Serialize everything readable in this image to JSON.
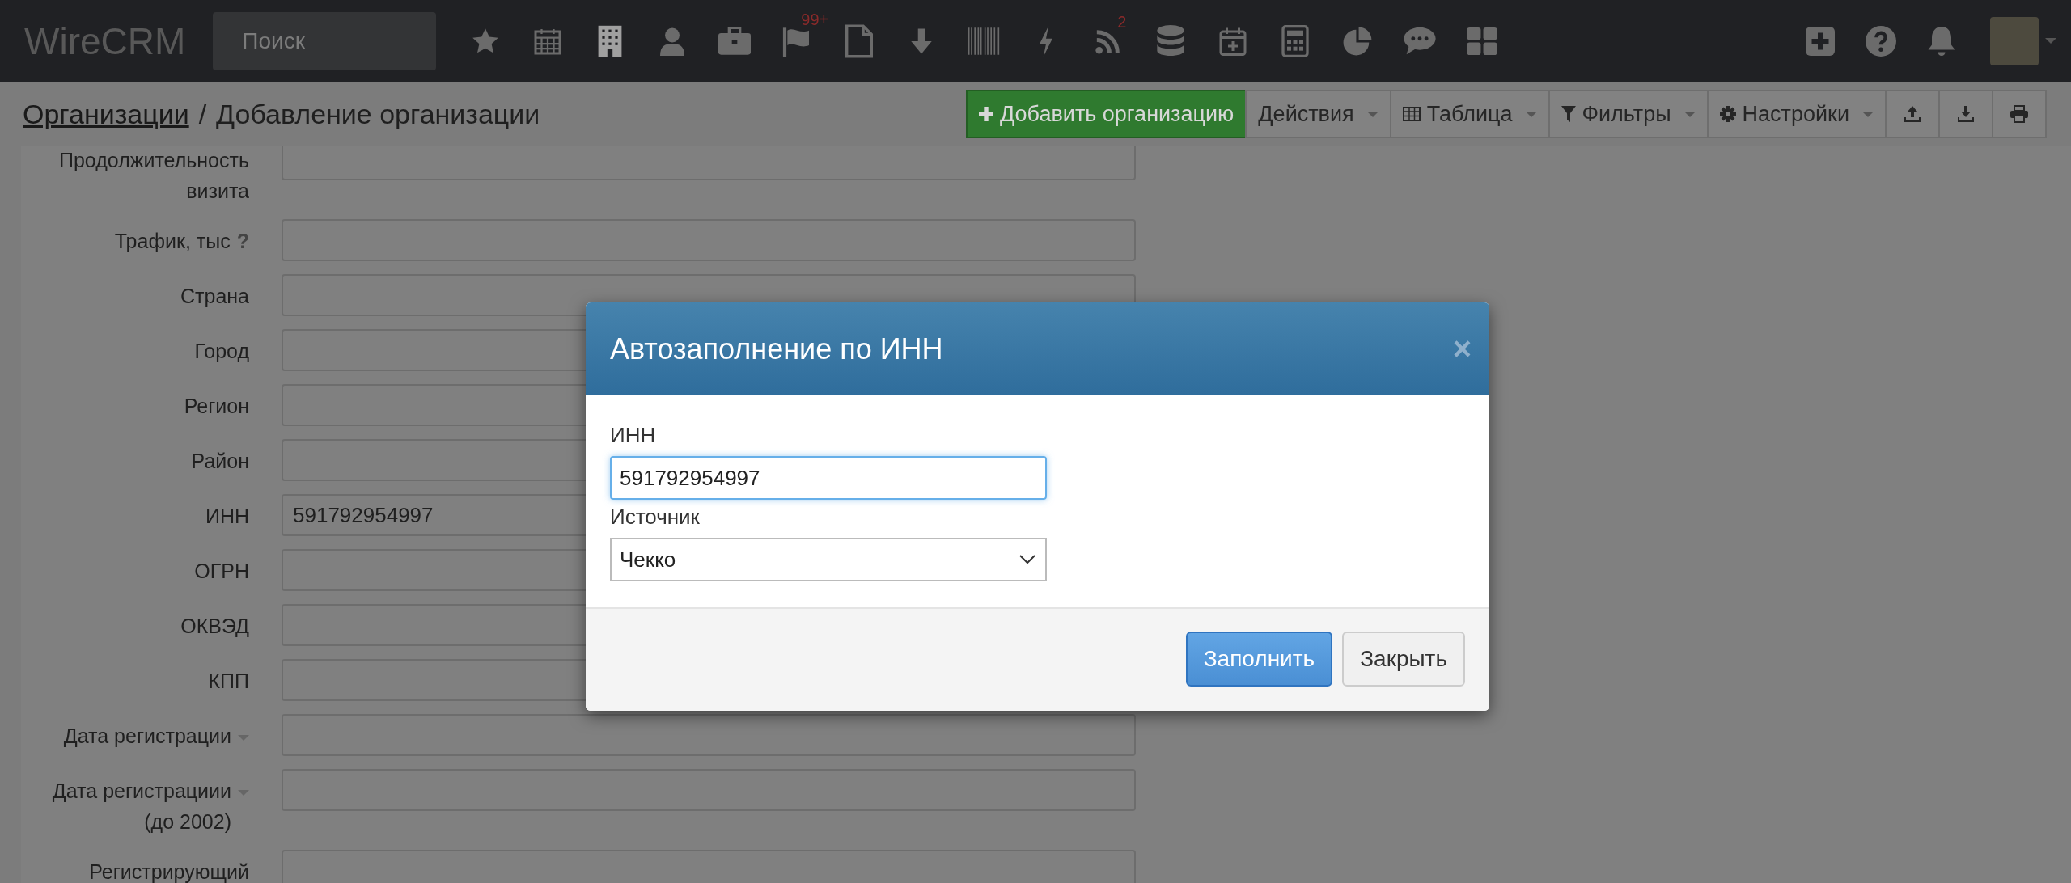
{
  "topbar": {
    "logo": "WireCRM",
    "search": {
      "placeholder": "Поиск"
    },
    "flag_badge": "99+",
    "feed_badge": "2"
  },
  "breadcrumb": {
    "link": "Организации",
    "separator": "/",
    "current": "Добавление организации"
  },
  "toolbar": {
    "add_button": "Добавить организацию",
    "menus": [
      {
        "label": "Действия"
      },
      {
        "label": "Таблица"
      },
      {
        "label": "Фильтры"
      },
      {
        "label": "Настройки"
      }
    ]
  },
  "form": {
    "fields": [
      {
        "label": "Продолжительность визита",
        "kind": "plain"
      },
      {
        "label": "Трафик, тыс",
        "kind": "help",
        "help": "?"
      },
      {
        "label": "Страна",
        "kind": "plain"
      },
      {
        "label": "Город",
        "kind": "plain"
      },
      {
        "label": "Регион",
        "kind": "plain"
      },
      {
        "label": "Район",
        "kind": "plain"
      },
      {
        "label": "ИНН",
        "kind": "plain",
        "value": "591792954997"
      },
      {
        "label": "ОГРН",
        "kind": "plain"
      },
      {
        "label": "ОКВЭД",
        "kind": "plain"
      },
      {
        "label": "КПП",
        "kind": "plain"
      },
      {
        "label": "Дата регистрации",
        "kind": "dropdown"
      },
      {
        "label": "Дата регистрациии (до 2002)",
        "kind": "dropdown"
      },
      {
        "label": "Регистрирующий",
        "kind": "plain"
      }
    ]
  },
  "modal": {
    "title": "Автозаполнение по ИНН",
    "close": "×",
    "inn_label": "ИНН",
    "inn_value": "591792954997",
    "source_label": "Источник",
    "source_value": "Чекко",
    "buttons": [
      {
        "label": "Заполнить",
        "kind": "primary"
      },
      {
        "label": "Закрыть",
        "kind": "default"
      }
    ]
  }
}
